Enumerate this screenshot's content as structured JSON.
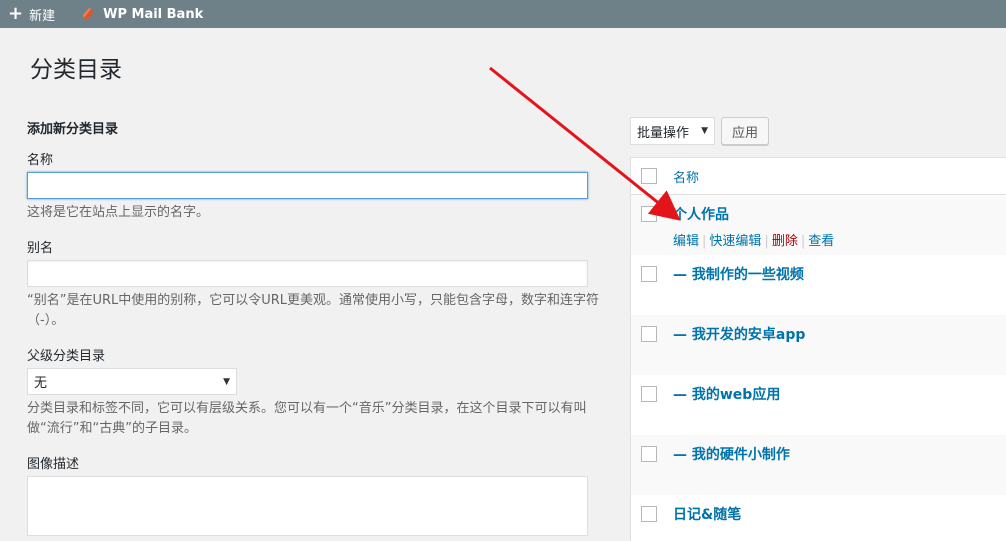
{
  "adminbar": {
    "new_label": "新建",
    "plugin_label": "WP Mail Bank"
  },
  "page": {
    "title": "分类目录"
  },
  "form": {
    "heading": "添加新分类目录",
    "name_label": "名称",
    "name_value": "",
    "name_desc": "这将是它在站点上显示的名字。",
    "slug_label": "别名",
    "slug_value": "",
    "slug_desc": "“别名”是在URL中使用的别称，它可以令URL更美观。通常使用小写，只能包含字母，数字和连字符（-）。",
    "parent_label": "父级分类目录",
    "parent_value": "无",
    "parent_desc": "分类目录和标签不同，它可以有层级关系。您可以有一个“音乐”分类目录，在这个目录下可以有叫做“流行”和“古典”的子目录。",
    "image_label": "图像描述"
  },
  "bulk": {
    "select_value": "批量操作",
    "apply_label": "应用"
  },
  "table": {
    "header_label": "名称",
    "rows": [
      {
        "title": "个人作品"
      },
      {
        "title": "— 我制作的一些视频"
      },
      {
        "title": "— 我开发的安卓app"
      },
      {
        "title": "— 我的web应用"
      },
      {
        "title": "— 我的硬件小制作"
      },
      {
        "title": "日记&随笔"
      }
    ],
    "actions": {
      "edit": "编辑",
      "quick_edit": "快速编辑",
      "delete": "删除",
      "view": "查看"
    }
  },
  "colors": {
    "adminbar": "#6f8188",
    "link": "#0073aa",
    "delete": "#aa0000",
    "annotation_arrow": "#e3151a"
  }
}
